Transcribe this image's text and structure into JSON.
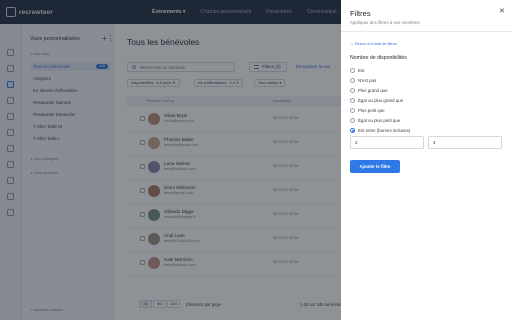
{
  "app": {
    "logo_text": "recrewteer"
  },
  "topnav": {
    "items": [
      {
        "label": "Événements ▾"
      },
      {
        "label": "Champs personnalisés"
      },
      {
        "label": "Paramètres"
      },
      {
        "label": "Communiqué"
      }
    ]
  },
  "sidebar": {
    "title": "Vues personnalisées",
    "add_label": "+⋮",
    "group_label": "▾  Mes vues",
    "items": [
      {
        "label": "Tous les bénévoles",
        "badge": "345",
        "selected": true
      },
      {
        "label": "Assignés"
      },
      {
        "label": "En attente d'affectation"
      },
      {
        "label": "Restaurant Samedi"
      },
      {
        "label": "Restaurant Dimanche"
      },
      {
        "label": "T-Shirt Taille M"
      },
      {
        "label": "T-Shirt Taille L"
      }
    ],
    "group2_label": "▸  Vues partagées",
    "group3_label": "▸  Vues archivées",
    "new_folder": "+  Nouveau dossier"
  },
  "main": {
    "title": "Tous les bénévoles",
    "search_placeholder": "Rechercher un bénévole",
    "filters_label": "Filtres (3)",
    "save_view_label": "Enregistrer la vue",
    "chips": [
      {
        "label": "Disponibilités : 4-5 jours ✕"
      },
      {
        "label": "Nb d'affectations : 1-4 ✕"
      },
      {
        "label": "Tous statuts ▾"
      }
    ],
    "columns": {
      "name": "Prénom Nom ▴",
      "date": "Inscription"
    },
    "rows": [
      {
        "name": "Olivia Bryie",
        "email": "olivia@gmail.com",
        "date": "08.03.24 05:08",
        "avatar_color": "#b98a7a"
      },
      {
        "name": "Phoenix Baker",
        "email": "phoenix@gmail.com",
        "date": "08.03.24 05:08",
        "avatar_color": "#c7a58c"
      },
      {
        "name": "Lana Steiner",
        "email": "lana@outlook.com",
        "date": "08.03.24 05:08",
        "avatar_color": "#8b7fa8"
      },
      {
        "name": "Demi Wilkinson",
        "email": "demi@gmail.com",
        "date": "08.03.24 05:08",
        "avatar_color": "#a8725e"
      },
      {
        "name": "Orlando Diggs",
        "email": "orlando@orange.fr",
        "date": "08.03.24 05:08",
        "avatar_color": "#6f8b7a"
      },
      {
        "name": "Andi Lane",
        "email": "andi@ORANGE.com",
        "date": "08.03.24 05:08",
        "avatar_color": "#9a8f80"
      },
      {
        "name": "Kate Morrison",
        "email": "kate@outlook.com",
        "date": "08.03.24 05:08",
        "avatar_color": "#c48f84"
      }
    ],
    "pager": {
      "sizes": [
        "25",
        "50",
        "100"
      ],
      "selected": "25",
      "per_page_label": "Éléments par page",
      "range_label": "1-25 sur 345 bénévoles"
    }
  },
  "panel": {
    "title": "Filtres",
    "close_label": "✕",
    "subtitle": "Appliquer des filtres à vos membres",
    "back_label": "←  Retour à la liste de filtres",
    "section_title": "Nombre de disponibilités",
    "options": [
      {
        "label": "Est"
      },
      {
        "label": "N'est pas"
      },
      {
        "label": "Plus grand que"
      },
      {
        "label": "Égal ou plus grand que"
      },
      {
        "label": "Plus petit que"
      },
      {
        "label": "Égal ou plus petit que"
      },
      {
        "label": "Est entre (bornes incluses)"
      }
    ],
    "selected_option": "Est entre (bornes incluses)",
    "min_value": "2",
    "max_value": "4",
    "apply_label": "Ajouter le filtre"
  }
}
